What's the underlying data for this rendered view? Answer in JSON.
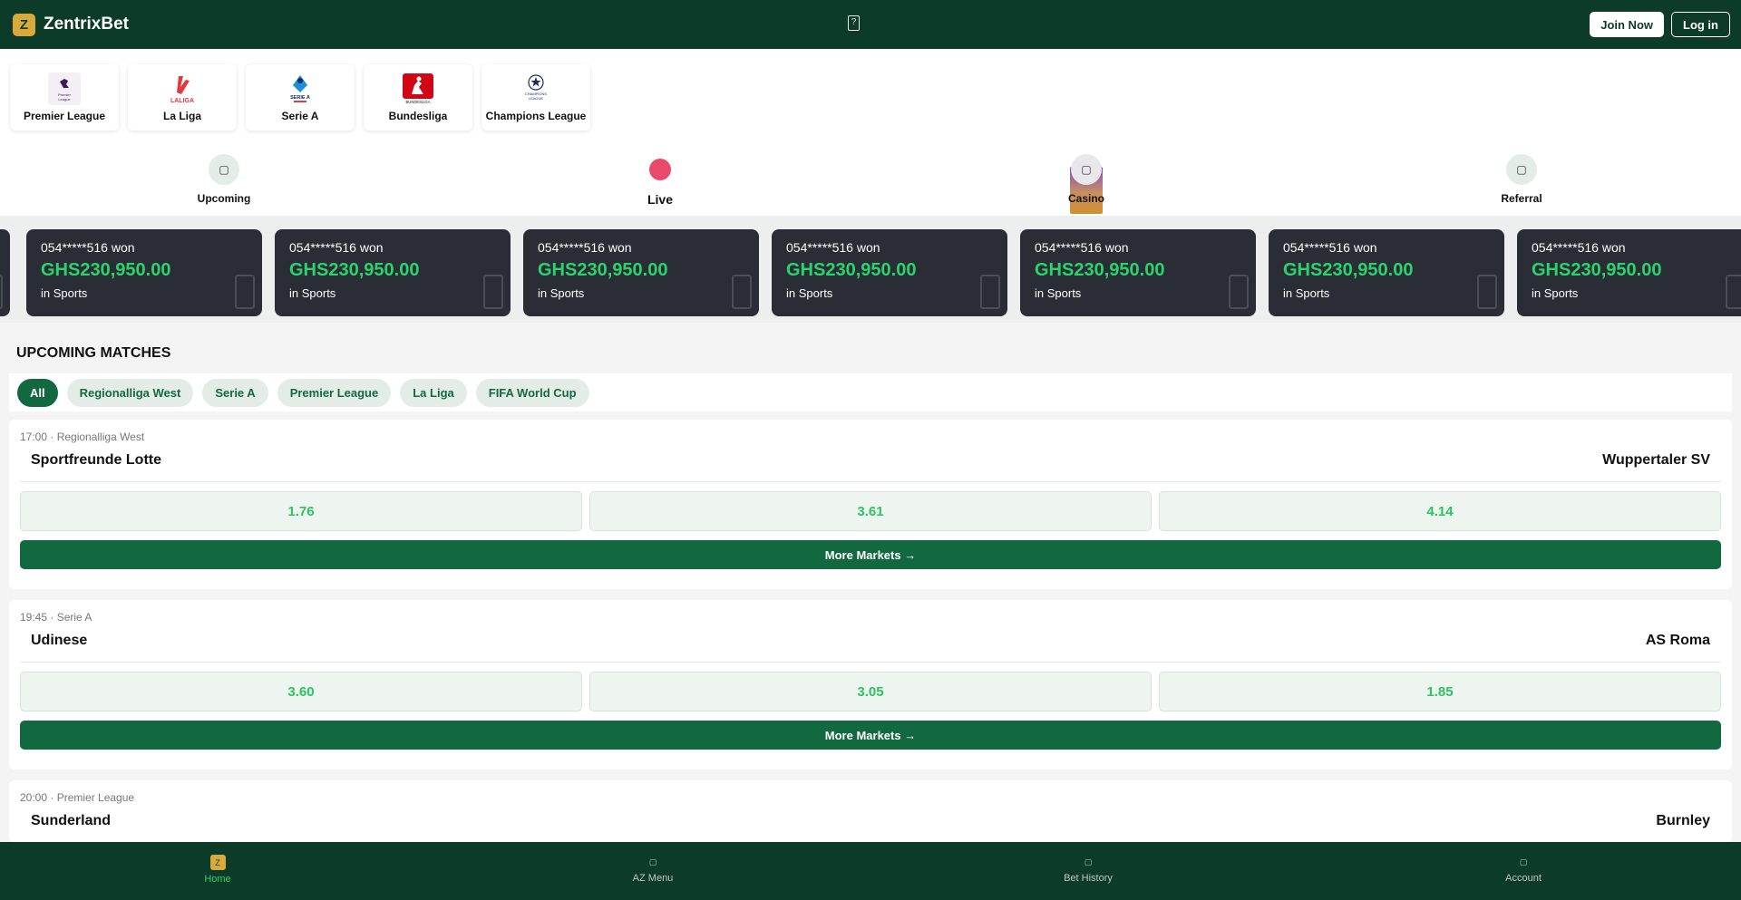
{
  "header": {
    "brand": "ZentrixBet",
    "brand_logo_glyph": "Z",
    "join_label": "Join Now",
    "login_label": "Log in"
  },
  "leagues": [
    {
      "name": "Premier League",
      "logo_text": "Premier League"
    },
    {
      "name": "La Liga",
      "logo_text": "LALIGA"
    },
    {
      "name": "Serie A",
      "logo_text": "SERIE A"
    },
    {
      "name": "Bundesliga",
      "logo_text": "BUNDESLIGA"
    },
    {
      "name": "Champions League",
      "logo_text": "CHAMPIONS LEAGUE"
    }
  ],
  "quicknav": {
    "upcoming": "Upcoming",
    "live": "Live",
    "casino": "Casino",
    "referral": "Referral"
  },
  "winners": [
    {
      "user": "054*****516 won",
      "amount": "GHS230,950.00",
      "category": "in Sports"
    },
    {
      "user": "054*****516 won",
      "amount": "GHS230,950.00",
      "category": "in Sports"
    },
    {
      "user": "054*****516 won",
      "amount": "GHS230,950.00",
      "category": "in Sports"
    },
    {
      "user": "054*****516 won",
      "amount": "GHS230,950.00",
      "category": "in Sports"
    },
    {
      "user": "054*****516 won",
      "amount": "GHS230,950.00",
      "category": "in Sports"
    },
    {
      "user": "054*****516 won",
      "amount": "GHS230,950.00",
      "category": "in Sports"
    },
    {
      "user": "054*****516 won",
      "amount": "GHS230,950.00",
      "category": "in Sports"
    }
  ],
  "upcoming": {
    "title": "UPCOMING MATCHES",
    "filters": [
      "All",
      "Regionalliga West",
      "Serie A",
      "Premier League",
      "La Liga",
      "FIFA World Cup"
    ],
    "more_label": "More Markets →",
    "matches": [
      {
        "meta": "17:00 · Regionalliga West",
        "home": "Sportfreunde Lotte",
        "away": "Wuppertaler SV",
        "odds": [
          "1.76",
          "3.61",
          "4.14"
        ]
      },
      {
        "meta": "19:45 · Serie A",
        "home": "Udinese",
        "away": "AS Roma",
        "odds": [
          "3.60",
          "3.05",
          "1.85"
        ]
      },
      {
        "meta": "20:00 · Premier League",
        "home": "Sunderland",
        "away": "Burnley"
      }
    ]
  },
  "bottomnav": {
    "home": "Home",
    "az_menu": "AZ Menu",
    "bet_history": "Bet History",
    "account": "Account"
  },
  "colors": {
    "header_bg": "#0c3b2a",
    "accent_green": "#13693f",
    "win_green": "#2bd46b",
    "live_red": "#e94a6b",
    "brand_gold": "#d9a93b"
  }
}
